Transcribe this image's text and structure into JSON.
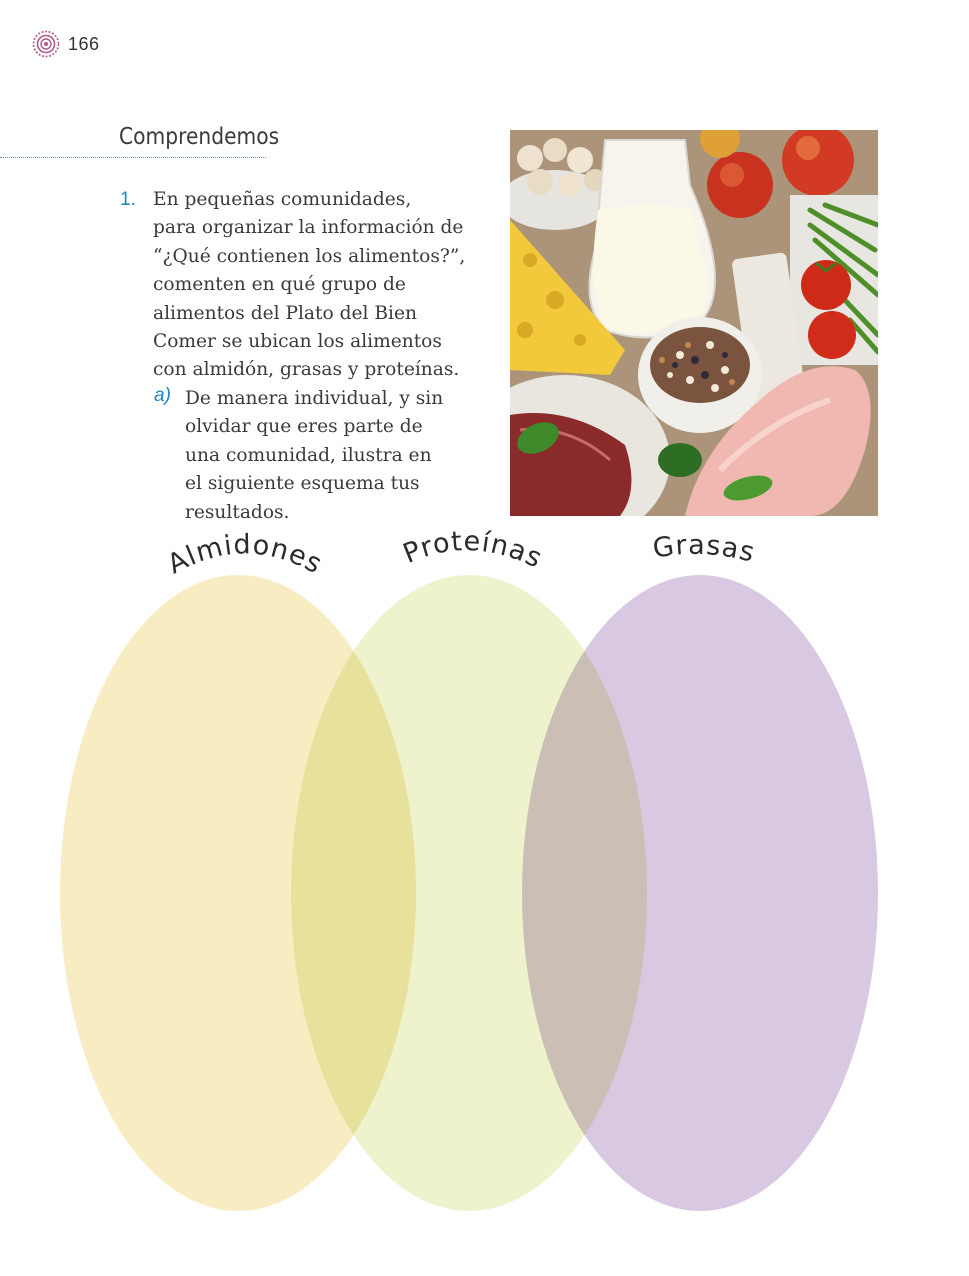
{
  "page": {
    "number": "166"
  },
  "section": {
    "title": "Comprendemos"
  },
  "question": {
    "number": "1.",
    "lines": [
      "En pequeñas comunidades,",
      "para organizar la información de",
      "“¿Qué contienen los alimentos?”,",
      "comenten en qué grupo de",
      "alimentos del Plato del Bien",
      "Comer se ubican los alimentos",
      "con almidón, grasas y proteínas."
    ],
    "sub": {
      "label": "a)",
      "lines": [
        "De manera individual, y sin",
        "olvidar que eres parte de",
        "una comunidad, ilustra en",
        "el siguiente esquema tus",
        "resultados."
      ]
    }
  },
  "venn": {
    "labels": [
      "Almidones",
      "Proteínas",
      "Grasas"
    ],
    "colors": [
      "#f8edc2",
      "#eef2cd",
      "#d9c8e1"
    ]
  },
  "icons": {
    "page_marker": "concentric-circle-icon"
  }
}
